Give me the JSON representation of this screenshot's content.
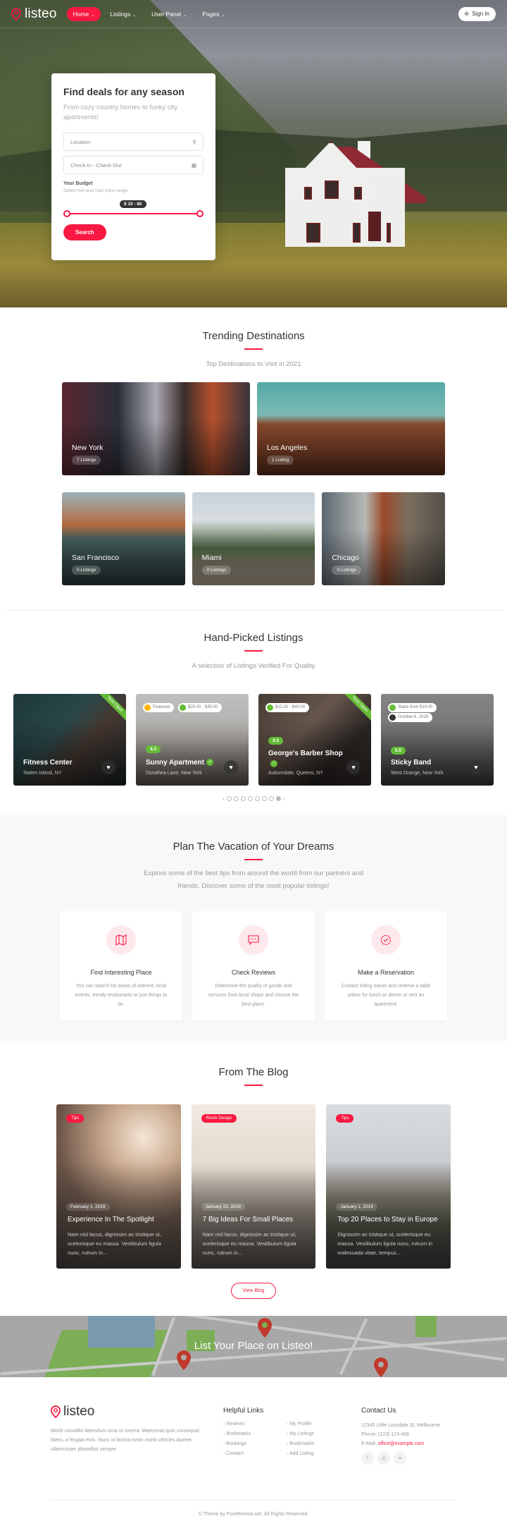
{
  "brand": {
    "name": "listeo",
    "accent": "#f91942",
    "green": "#64bc36"
  },
  "nav": {
    "items": [
      {
        "label": "Home",
        "active": true
      },
      {
        "label": "Listings"
      },
      {
        "label": "User Panel"
      },
      {
        "label": "Pages"
      }
    ],
    "signin_label": "Sign In"
  },
  "hero": {
    "title": "Find deals for any season",
    "subtitle": "From cozy country homes to funky city apartments!",
    "location_placeholder": "Location",
    "dates_placeholder": "Check-In - Check-Out",
    "budget_label": "Your Budget",
    "budget_hint": "Select min and max price range",
    "budget_value": "$ 10 - 80",
    "search_label": "Search"
  },
  "trending": {
    "title": "Trending Destinations",
    "subtitle": "Top Destinations to Visit in 2021",
    "destinations": [
      {
        "name": "New York",
        "count": "7 Listings"
      },
      {
        "name": "Los Angeles",
        "count": "1 Listing"
      },
      {
        "name": "San Francisco",
        "count": "0 Listings"
      },
      {
        "name": "Miami",
        "count": "0 Listings"
      },
      {
        "name": "Chicago",
        "count": "0 Listings"
      }
    ]
  },
  "handpicked": {
    "title": "Hand-Picked Listings",
    "subtitle": "A selection of Listings Verified For Quality",
    "listings": [
      {
        "title": "Fitness Center",
        "location": "Staten Island, NY",
        "ribbon": "Now Open"
      },
      {
        "title": "Sunny Apartment",
        "location": "Dorothea Lane, New York",
        "rating": "4.3",
        "featured": "Featured",
        "price": "$25.00 - $35.00"
      },
      {
        "title": "George's Barber Shop",
        "location": "Auburndale, Queens, NY",
        "rating": "4.3",
        "price": "$12.00 - $40.00",
        "ribbon": "Now Open"
      },
      {
        "title": "Sticky Band",
        "location": "West Orange, New York",
        "rating": "5.0",
        "price": "Starts from $10.00",
        "date": "October 6, 2019"
      }
    ],
    "pager": {
      "pages": 8,
      "active": 8
    }
  },
  "plan": {
    "title": "Plan The Vacation of Your Dreams",
    "subtitle": "Explore some of the best tips from around the world from our partners and friends. Discover some of the most popular listings!",
    "cards": [
      {
        "icon": "map-icon",
        "title": "Find Interesting Place",
        "text": "You can search for areas of interest, local events, trendy restaurants or just things to do."
      },
      {
        "icon": "chat-icon",
        "title": "Check Reviews",
        "text": "Determine the quality of goods and services from local shops and choose the best place."
      },
      {
        "icon": "check-badge-icon",
        "title": "Make a Reservation",
        "text": "Contact listing owner and reserve a table online for lunch or dinner or rent an apartment."
      }
    ]
  },
  "blog": {
    "title": "From The Blog",
    "posts": [
      {
        "category": "Tips",
        "date": "February 1, 2019",
        "title": "Experience In The Spotlight",
        "excerpt": "Nam nisl lacus, dignissim ac tristique ut, scelerisque eu massa. Vestibulum ligula nunc, rutrum in..."
      },
      {
        "category": "Room Design",
        "date": "January 22, 2019",
        "title": "7 Big Ideas For Small Places",
        "excerpt": "Nam nisl lacus, dignissim ac tristique ut, scelerisque eu massa. Vestibulum ligula nunc, rutrum in..."
      },
      {
        "category": "Tips",
        "date": "January 1, 2019",
        "title": "Top 20 Places to Stay in Europe",
        "excerpt": "Dignissim ac tristique ut, scelerisque eu massa. Vestibulum ligula nunc, rutrum in malesuada vitae, tempus..."
      }
    ],
    "view_label": "View Blog"
  },
  "cta": {
    "title": "List Your Place on Listeo!"
  },
  "footer": {
    "description": "Morbi convallis bibendum urna ut viverra. Maecenas quis consequat libero, a feugiat eros. Nunc ut lacinia tortor morbi ultricies laoreet ullamcorper phasellus semper.",
    "links_title": "Helpful Links",
    "links_col1": [
      "Reviews",
      "Bookmarks",
      "Bookings",
      "Contact"
    ],
    "links_col2": [
      "My Profile",
      "My Listings",
      "Bookmarks",
      "Add Listing"
    ],
    "contact_title": "Contact Us",
    "address": "12345 Little Lonsdale St, Melbourne",
    "phone": "Phone: (123) 123-456",
    "email_label": "E-Mail: ",
    "email": "office@example.com",
    "social": [
      "facebook-icon",
      "instagram-icon",
      "twitter-icon"
    ],
    "copyright": "© Theme by Purethemes.net. All Rights Reserved."
  }
}
